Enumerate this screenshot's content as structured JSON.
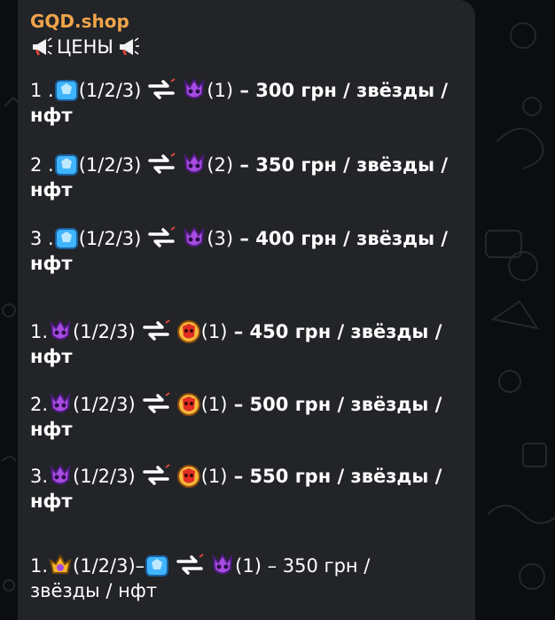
{
  "message": {
    "sender": "GQD.shop",
    "title": "ЦЕНЫ",
    "rows": [
      {
        "num": "1 .",
        "left": "(1/2/3)",
        "right": "(1)",
        "price": " – 300 грн / звёзды /",
        "tail": "нфт"
      },
      {
        "num": "2 .",
        "left": "(1/2/3)",
        "right": "(2)",
        "price": " – 350 грн / звёзды /",
        "tail": "нфт"
      },
      {
        "num": "3 .",
        "left": "(1/2/3)",
        "right": "(3)",
        "price": " – 400 грн / звёзды /",
        "tail": "нфт"
      },
      {
        "num": "1.",
        "left": "(1/2/3)",
        "right": "(1)",
        "price": " – 450 грн / звёзды /",
        "tail": "нфт"
      },
      {
        "num": "2.",
        "left": "(1/2/3)",
        "right": "(1)",
        "price": " – 500 грн / звёзды /",
        "tail": "нфт"
      },
      {
        "num": "3.",
        "left": "(1/2/3)",
        "right": "(1)",
        "price": " – 550 грн  / звёзды /",
        "tail": "нфт"
      },
      {
        "num": "1.",
        "left": "(1/2/3)–",
        "right": "(1)",
        "price": " – 350 грн /",
        "tail": "звёзды / нфт"
      }
    ]
  },
  "icons": {
    "blue_rank": "blue-crystal-icon",
    "purple_rank": "purple-skull-icon",
    "red_rank": "red-skull-icon",
    "gold_rank": "gold-crown-icon",
    "swap": "swap-arrows-icon",
    "megaphone": "megaphone-icon"
  },
  "colors": {
    "sender": "#f0a44a",
    "bubble": "#222428",
    "background": "#0b0d10"
  }
}
